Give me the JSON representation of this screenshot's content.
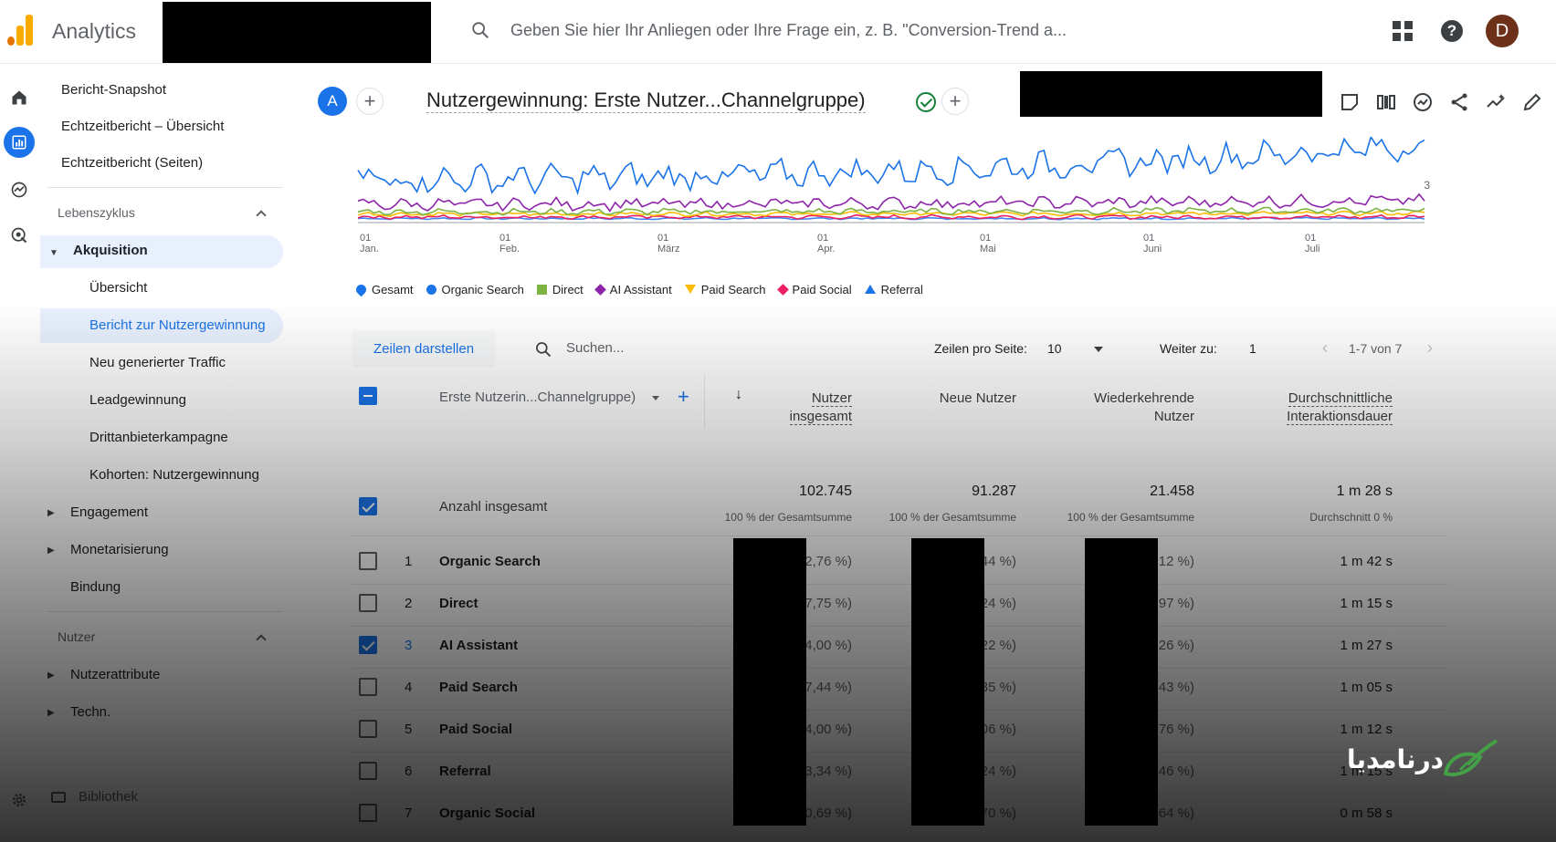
{
  "app": {
    "title": "Analytics",
    "search_placeholder": "Geben Sie hier Ihr Anliegen oder Ihre Frage ein, z. B. \"Conversion-Trend a...",
    "avatar_letter": "D",
    "help_glyph": "?"
  },
  "nav": {
    "top_items": [
      "Bericht-Snapshot",
      "Echtzeitbericht – Übersicht",
      "Echtzeitbericht (Seiten)"
    ],
    "section_lifecycle": "Lebenszyklus",
    "acquisition": "Akquisition",
    "acquisition_items": [
      "Übersicht",
      "Bericht zur Nutzergewinnung",
      "Neu generierter Traffic",
      "Leadgewinnung",
      "Drittanbieterkampagne",
      "Kohorten: Nutzergewinnung"
    ],
    "engagement": "Engagement",
    "monetization": "Monetarisierung",
    "retention": "Bindung",
    "section_users": "Nutzer",
    "user_attributes": "Nutzerattribute",
    "tech": "Techn.",
    "library": "Bibliothek"
  },
  "report": {
    "badge": "A",
    "title": "Nutzergewinnung: Erste Nutzer...Channelgruppe)",
    "plus": "+"
  },
  "chart_data": {
    "type": "line",
    "x_ticks": [
      {
        "day": "01",
        "month": "Jan."
      },
      {
        "day": "01",
        "month": "Feb."
      },
      {
        "day": "01",
        "month": "März"
      },
      {
        "day": "01",
        "month": "Apr."
      },
      {
        "day": "01",
        "month": "Mai"
      },
      {
        "day": "01",
        "month": "Juni"
      },
      {
        "day": "01",
        "month": "Juli"
      }
    ],
    "y_right_tick": "3",
    "series": [
      {
        "name": "Organic Search",
        "color": "#1a73e8",
        "level": 0.55,
        "trend": 0.45,
        "amp": 0.14
      },
      {
        "name": "AI Assistant",
        "color": "#8e24aa",
        "level": 0.22,
        "trend": 0.05,
        "amp": 0.06
      },
      {
        "name": "Direct",
        "color": "#7cb342",
        "level": 0.12,
        "trend": 0.02,
        "amp": 0.03
      },
      {
        "name": "Paid Search",
        "color": "#fbbc04",
        "level": 0.09,
        "trend": 0.01,
        "amp": 0.02
      },
      {
        "name": "Paid Social",
        "color": "#e91e63",
        "level": 0.05,
        "trend": 0.0,
        "amp": 0.02
      },
      {
        "name": "Referral",
        "color": "#4285f4",
        "level": 0.03,
        "trend": 0.0,
        "amp": 0.01
      }
    ],
    "legend": [
      {
        "name": "Gesamt",
        "shape": "drop",
        "color": "#1a73e8"
      },
      {
        "name": "Organic Search",
        "shape": "circle",
        "color": "#1a73e8"
      },
      {
        "name": "Direct",
        "shape": "square",
        "color": "#7cb342"
      },
      {
        "name": "AI Assistant",
        "shape": "diamond",
        "color": "#8e24aa"
      },
      {
        "name": "Paid Search",
        "shape": "triangle-down",
        "color": "#fbbc04"
      },
      {
        "name": "Paid Social",
        "shape": "diamond",
        "color": "#e91e63"
      },
      {
        "name": "Referral",
        "shape": "triangle-up",
        "color": "#1a73e8"
      }
    ]
  },
  "toolbar": {
    "show_rows": "Zeilen darstellen",
    "search_placeholder": "Suchen...",
    "rows_per_page_label": "Zeilen pro Seite:",
    "rows_per_page_value": "10",
    "goto_label": "Weiter zu:",
    "goto_value": "1",
    "range": "1-7 von 7"
  },
  "table": {
    "dimension_header": "Erste Nutzerin...Channelgruppe)",
    "col_total_users": "Nutzer insgesamt",
    "col_new_users": "Neue Nutzer",
    "col_returning_1": "Wiederkehrende",
    "col_returning_2": "Nutzer",
    "col_avg_1": "Durchschnittliche",
    "col_avg_2": "Interaktionsdauer",
    "totals": {
      "label": "Anzahl insgesamt",
      "total_users": "102.745",
      "new_users": "91.287",
      "returning": "21.458",
      "avg": "1 m 28 s",
      "total_users_sub": "100 % der Gesamtsumme",
      "new_users_sub": "100 % der Gesamtsumme",
      "returning_sub": "100 % der Gesamtsumme",
      "avg_sub": "Durchschnitt 0 %"
    },
    "rows": [
      {
        "idx": "1",
        "name": "Organic Search",
        "tu": "52,76 %)",
        "nu": "52,44 %)",
        "ru": "(59,12 %)",
        "avg": "1 m 42 s",
        "checked": false
      },
      {
        "idx": "2",
        "name": "Direct",
        "tu": "17,75 %)",
        "nu": "17,24 %)",
        "ru": "(19,97 %)",
        "avg": "1 m 15 s",
        "checked": false
      },
      {
        "idx": "3",
        "name": "AI Assistant",
        "tu": "14,00 %)",
        "nu": "14,22 %)",
        "ru": "(12,26 %)",
        "avg": "1 m 27 s",
        "checked": true
      },
      {
        "idx": "4",
        "name": "Paid Search",
        "tu": "(7,44 %)",
        "nu": "(7,35 %)",
        "ru": "(7,43 %)",
        "avg": "1 m 05 s",
        "checked": false
      },
      {
        "idx": "5",
        "name": "Paid Social",
        "tu": "(4,00 %)",
        "nu": "(4,06 %)",
        "ru": "(4,76 %)",
        "avg": "1 m 12 s",
        "checked": false
      },
      {
        "idx": "6",
        "name": "Referral",
        "tu": "(3,34 %)",
        "nu": "(3,24 %)",
        "ru": "(3,46 %)",
        "avg": "1 m 15 s",
        "checked": false
      },
      {
        "idx": "7",
        "name": "Organic Social",
        "tu": "(0,69 %)",
        "nu": "(0,70 %)",
        "ru": "(0,64 %)",
        "avg": "0 m 58 s",
        "checked": false
      }
    ]
  },
  "watermark": {
    "text": "درنامدیا"
  }
}
